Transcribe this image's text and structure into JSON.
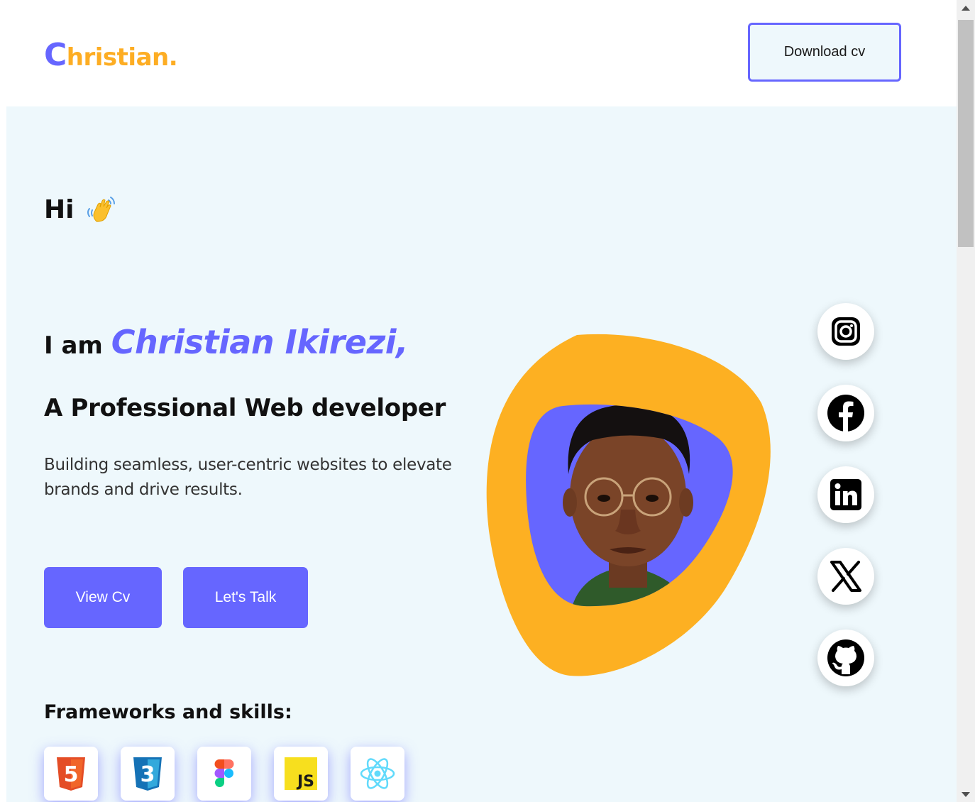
{
  "header": {
    "logo_first": "C",
    "logo_rest": "hristian",
    "logo_dot": ".",
    "download_label": "Download cv"
  },
  "hero": {
    "greeting": "Hi",
    "greeting_icon": "waving-hand-icon",
    "intro": "I am ",
    "name": "Christian Ikirezi,",
    "role": "A Professional Web developer",
    "description": "Building seamless, user-centric websites to elevate brands and drive results.",
    "buttons": {
      "view_cv": "View Cv",
      "lets_talk": "Let's Talk"
    }
  },
  "skills": {
    "title": "Frameworks and skills:",
    "items": [
      {
        "name": "html5-icon",
        "text": "5"
      },
      {
        "name": "css3-icon",
        "text": "3"
      },
      {
        "name": "figma-icon"
      },
      {
        "name": "javascript-icon",
        "text": "JS"
      },
      {
        "name": "react-icon"
      }
    ]
  },
  "social": [
    "instagram-icon",
    "facebook-icon",
    "linkedin-icon",
    "x-icon",
    "github-icon"
  ],
  "colors": {
    "accent": "#6666ff",
    "logo_orange": "#fdad23",
    "blob_orange": "#fdb022",
    "hero_bg": "#eef8fc"
  }
}
